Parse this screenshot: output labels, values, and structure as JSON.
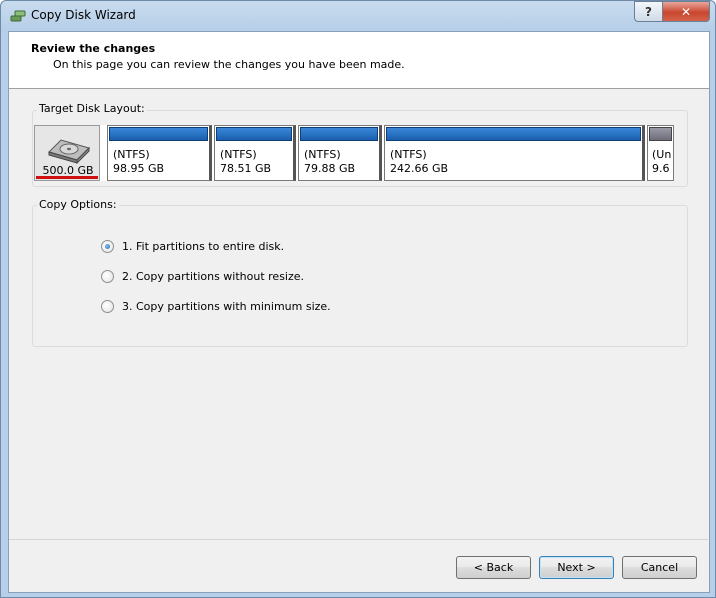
{
  "window": {
    "title": "Copy Disk Wizard",
    "help_label": "?",
    "close_label": "✕"
  },
  "header": {
    "title": "Review the changes",
    "subtitle": "On this page you can review the changes you have been made."
  },
  "target_layout": {
    "label": "Target Disk Layout:",
    "disk_size": "500.0 GB",
    "partitions": [
      {
        "fs": "(NTFS)",
        "size": "98.95 GB"
      },
      {
        "fs": "(NTFS)",
        "size": "78.51 GB"
      },
      {
        "fs": "(NTFS)",
        "size": "79.88 GB"
      },
      {
        "fs": "(NTFS)",
        "size": "242.66 GB"
      },
      {
        "fs": "(Un",
        "size": "9.6"
      }
    ]
  },
  "copy_options": {
    "label": "Copy Options:",
    "options": [
      {
        "label": "1. Fit partitions to entire disk.",
        "selected": true
      },
      {
        "label": "2. Copy partitions without resize.",
        "selected": false
      },
      {
        "label": "3. Copy partitions with minimum size.",
        "selected": false
      }
    ]
  },
  "buttons": {
    "back": "< Back",
    "next": "Next >",
    "cancel": "Cancel"
  }
}
